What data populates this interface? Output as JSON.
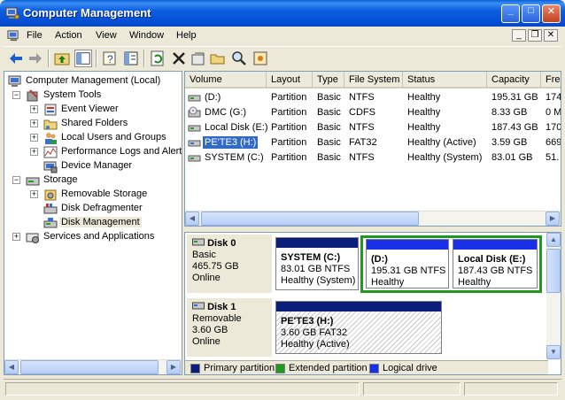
{
  "window": {
    "title": "Computer Management"
  },
  "menu": {
    "items": [
      "File",
      "Action",
      "View",
      "Window",
      "Help"
    ]
  },
  "tree": {
    "root": "Computer Management (Local)",
    "system_tools": "System Tools",
    "event_viewer": "Event Viewer",
    "shared_folders": "Shared Folders",
    "local_users": "Local Users and Groups",
    "perf_logs": "Performance Logs and Alerts",
    "device_manager": "Device Manager",
    "storage": "Storage",
    "removable_storage": "Removable Storage",
    "disk_defrag": "Disk Defragmenter",
    "disk_management": "Disk Management",
    "services": "Services and Applications"
  },
  "list": {
    "columns": [
      "Volume",
      "Layout",
      "Type",
      "File System",
      "Status",
      "Capacity",
      "Fre"
    ],
    "rows": [
      {
        "volume": "(D:)",
        "layout": "Partition",
        "type": "Basic",
        "fs": "NTFS",
        "status": "Healthy",
        "capacity": "195.31 GB",
        "free": "174"
      },
      {
        "volume": "DMC (G:)",
        "layout": "Partition",
        "type": "Basic",
        "fs": "CDFS",
        "status": "Healthy",
        "capacity": "8.33 GB",
        "free": "0 M"
      },
      {
        "volume": "Local Disk (E:)",
        "layout": "Partition",
        "type": "Basic",
        "fs": "NTFS",
        "status": "Healthy",
        "capacity": "187.43 GB",
        "free": "170"
      },
      {
        "volume": "PE'TE3 (H:)",
        "layout": "Partition",
        "type": "Basic",
        "fs": "FAT32",
        "status": "Healthy (Active)",
        "capacity": "3.59 GB",
        "free": "669"
      },
      {
        "volume": "SYSTEM (C:)",
        "layout": "Partition",
        "type": "Basic",
        "fs": "NTFS",
        "status": "Healthy (System)",
        "capacity": "83.01 GB",
        "free": "51."
      }
    ]
  },
  "disks": {
    "disk0": {
      "name": "Disk 0",
      "kind": "Basic",
      "size": "465.75 GB",
      "state": "Online",
      "parts": [
        {
          "name": "SYSTEM  (C:)",
          "size": "83.01 GB NTFS",
          "status": "Healthy (System)"
        },
        {
          "name": "(D:)",
          "size": "195.31 GB NTFS",
          "status": "Healthy"
        },
        {
          "name": "Local Disk  (E:)",
          "size": "187.43 GB NTFS",
          "status": "Healthy"
        }
      ]
    },
    "disk1": {
      "name": "Disk 1",
      "kind": "Removable",
      "size": "3.60 GB",
      "state": "Online",
      "parts": [
        {
          "name": "PE'TE3  (H:)",
          "size": "3.60 GB FAT32",
          "status": "Healthy (Active)"
        }
      ]
    }
  },
  "legend": [
    "Primary partition",
    "Extended partition",
    "Logical drive"
  ],
  "colors": {
    "primary": "#0a1e7a",
    "extended": "#1f9a1f",
    "logical": "#1a30e8",
    "selection": "#316ac5"
  }
}
